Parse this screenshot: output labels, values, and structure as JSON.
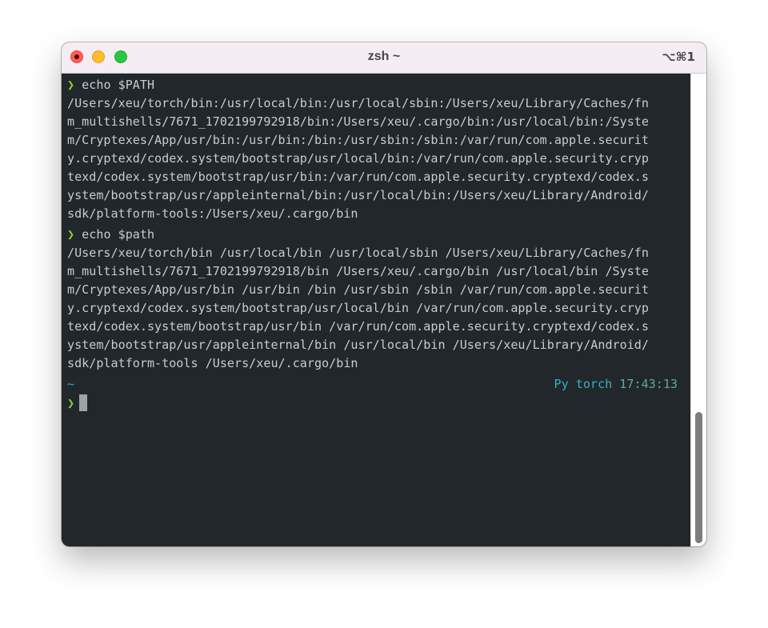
{
  "window": {
    "title": "zsh ~",
    "shortcut": "⌥⌘1"
  },
  "terminal": {
    "lines": [
      {
        "prompt": "❯",
        "text": " echo $PATH"
      },
      {
        "text": "/Users/xeu/torch/bin:/usr/local/bin:/usr/local/sbin:/Users/xeu/Library/Caches/fn"
      },
      {
        "text": "m_multishells/7671_1702199792918/bin:/Users/xeu/.cargo/bin:/usr/local/bin:/Syste"
      },
      {
        "text": "m/Cryptexes/App/usr/bin:/usr/bin:/bin:/usr/sbin:/sbin:/var/run/com.apple.securit"
      },
      {
        "text": "y.cryptexd/codex.system/bootstrap/usr/local/bin:/var/run/com.apple.security.cryp"
      },
      {
        "text": "texd/codex.system/bootstrap/usr/bin:/var/run/com.apple.security.cryptexd/codex.s"
      },
      {
        "text": "ystem/bootstrap/usr/appleinternal/bin:/usr/local/bin:/Users/xeu/Library/Android/"
      },
      {
        "text": "sdk/platform-tools:/Users/xeu/.cargo/bin"
      },
      {
        "prompt": "❯",
        "text": " echo $path"
      },
      {
        "text": "/Users/xeu/torch/bin /usr/local/bin /usr/local/sbin /Users/xeu/Library/Caches/fn"
      },
      {
        "text": "m_multishells/7671_1702199792918/bin /Users/xeu/.cargo/bin /usr/local/bin /Syste"
      },
      {
        "text": "m/Cryptexes/App/usr/bin /usr/bin /bin /usr/sbin /sbin /var/run/com.apple.securit"
      },
      {
        "text": "y.cryptexd/codex.system/bootstrap/usr/local/bin /var/run/com.apple.security.cryp"
      },
      {
        "text": "texd/codex.system/bootstrap/usr/bin /var/run/com.apple.security.cryptexd/codex.s"
      },
      {
        "text": "ystem/bootstrap/usr/appleinternal/bin /usr/local/bin /Users/xeu/Library/Android/"
      },
      {
        "text": "sdk/platform-tools /Users/xeu/.cargo/bin"
      }
    ],
    "prompt_dir": "~",
    "status_env": "Py torch",
    "status_time": "17:43:13",
    "input_prompt": "❯",
    "input_value": ""
  },
  "colors": {
    "background": "#22272b",
    "text": "#c8ccd0",
    "prompt": "#8fcf2f",
    "directory": "#3aa6c9",
    "env": "#36b1c2",
    "time": "#5fa7a4"
  }
}
